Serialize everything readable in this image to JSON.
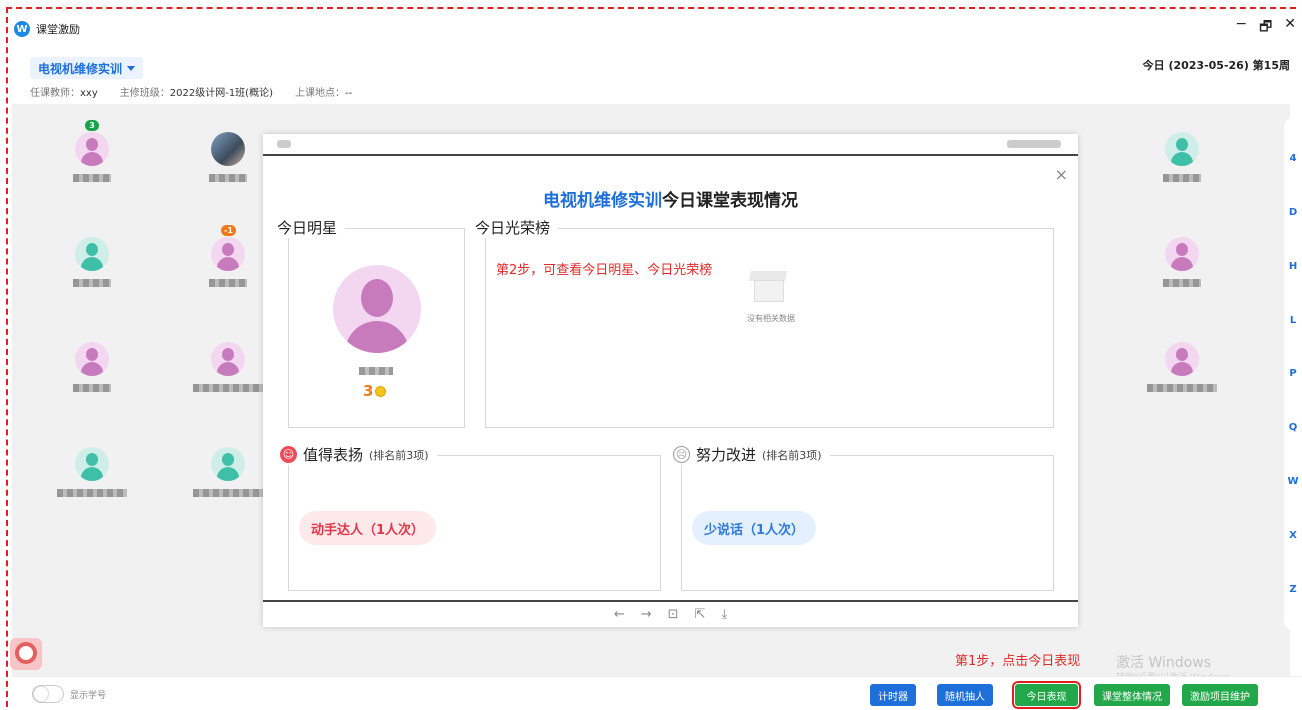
{
  "app": {
    "title": "课堂激励",
    "logo_letter": "W"
  },
  "window_controls": {
    "minimize": "−",
    "restore": "🗗",
    "close": "✕"
  },
  "course": {
    "name": "电视机维修实训"
  },
  "info": {
    "teacher_label": "任课教师：",
    "teacher": "xxy",
    "class_label": "主修班级：",
    "class": "2022级计网-1班(概论)",
    "place_label": "上课地点：",
    "place": "--"
  },
  "date_text": "今日 (2023-05-26)  第15周",
  "students": [
    {
      "badge": "3",
      "badge_color": "#19a34a",
      "avatar": "pink"
    },
    {
      "avatar": "photo"
    },
    {
      "avatar": "teal"
    },
    {
      "badge": "-1",
      "badge_color": "#f07a16",
      "avatar": "pink"
    },
    {
      "avatar": "pink"
    },
    {
      "avatar": "pink"
    },
    {
      "avatar": "teal"
    },
    {
      "avatar": "teal"
    },
    {
      "avatar": "teal"
    },
    {
      "avatar": "pink"
    },
    {
      "avatar": "pink"
    }
  ],
  "alphabet_index": [
    "4",
    "D",
    "H",
    "L",
    "P",
    "Q",
    "W",
    "X",
    "Z"
  ],
  "modal": {
    "title_highlight": "电视机维修实训",
    "title_rest": "今日课堂表现情况",
    "close": "×",
    "star_label": "今日明星",
    "star_score": "3",
    "honor_label": "今日光荣榜",
    "annotation_step2": "第2步，可查看今日明星、今日光荣榜",
    "empty_text": "没有相关数据",
    "praise": {
      "label": "值得表扬",
      "note": "(排名前3项)",
      "item": "动手达人（1人次）"
    },
    "improve": {
      "label": "努力改进",
      "note": "(排名前3项)",
      "item": "少说话（1人次）"
    },
    "footer_icons": [
      "←",
      "→",
      "⊡",
      "⇱",
      "⤓"
    ]
  },
  "toggle_label": "显示学号",
  "annotation_step1": "第1步，点击今日表现",
  "buttons": {
    "timer": "计时器",
    "random": "随机抽人",
    "today": "今日表现",
    "overall": "课堂整体情况",
    "maintain": "激励项目维护"
  },
  "watermark": {
    "line1": "激活 Windows",
    "line2": "转到\"设置\"以激活 Windows。"
  },
  "colors": {
    "accent": "#1e6fd9",
    "green": "#22a84a",
    "annotation": "#e02020"
  }
}
